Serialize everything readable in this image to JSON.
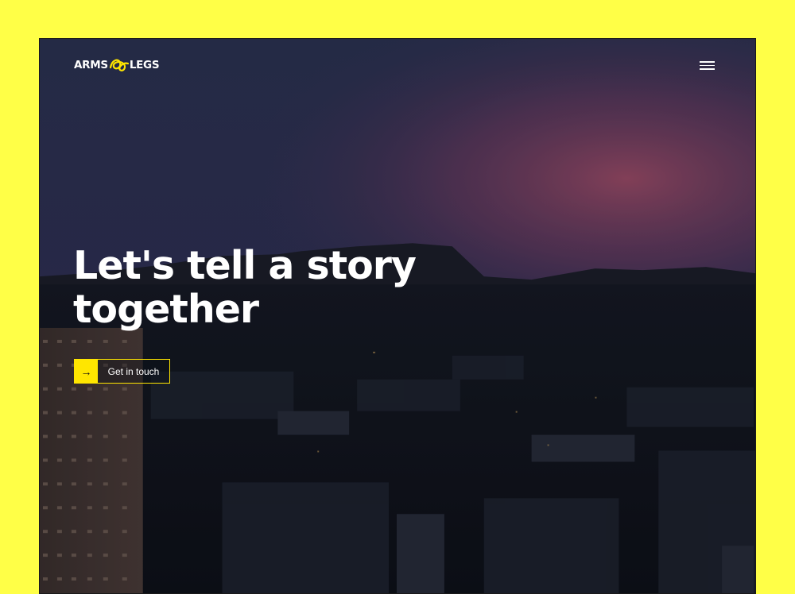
{
  "brand": {
    "logo_left": "ARMS",
    "logo_right": "LEGS",
    "logo_mark": "squiggle-logo-icon",
    "accent_color": "#ffe600",
    "page_background": "#ffff47"
  },
  "header": {
    "menu_icon": "hamburger-menu-icon"
  },
  "hero": {
    "headline_line1": "Let's tell a story",
    "headline_line2": "together",
    "cta_label": "Get in touch",
    "cta_icon": "arrow-right-icon",
    "cta_icon_glyph": "→",
    "background": "dusk-city-skyline-photo"
  }
}
